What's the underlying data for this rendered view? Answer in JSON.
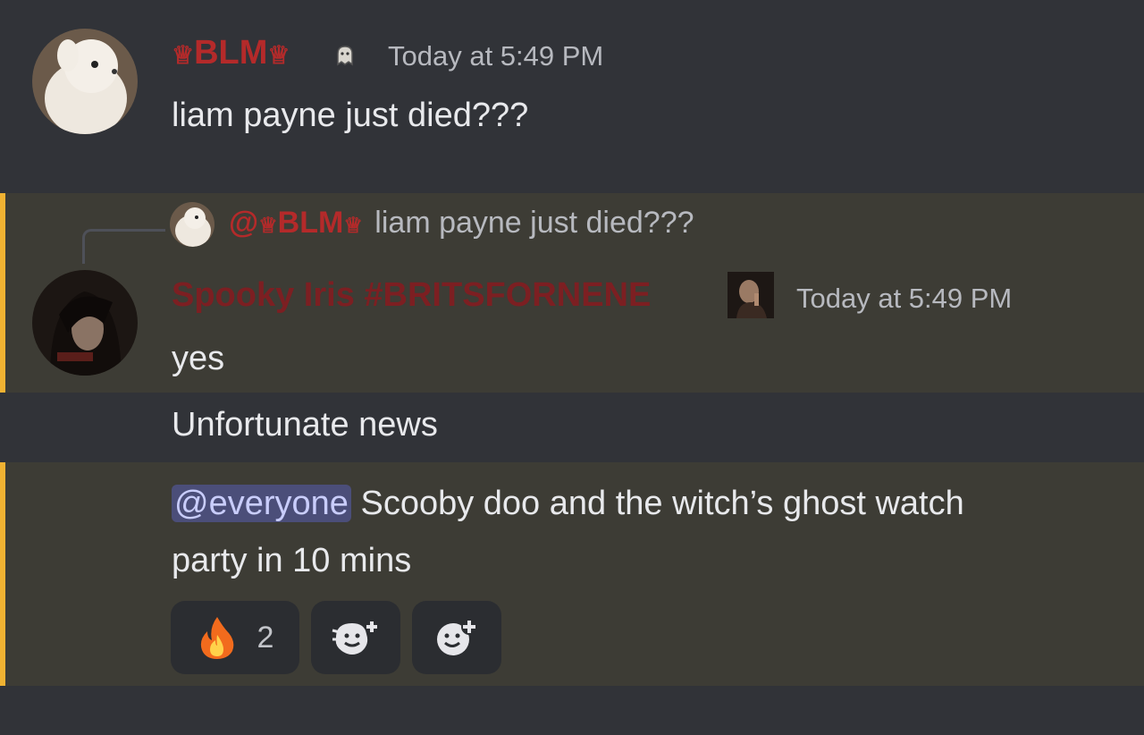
{
  "messages": [
    {
      "author": "BLM",
      "crown": "♕",
      "time": "Today at 5:49 PM",
      "text": "liam payne just died???"
    },
    {
      "reply": {
        "author": "BLM",
        "prefix": "@",
        "text": "liam payne just died???"
      },
      "author": "Spooky Iris #BRITSFORNENE",
      "time": "Today at 5:49 PM",
      "lines": [
        "yes",
        "Unfortunate news"
      ]
    },
    {
      "mention": "@everyone",
      "text_line1": "Scooby doo and the witch’s ghost watch",
      "text_line2": "party in 10 mins"
    }
  ],
  "reactions": [
    {
      "icon": "fire-emoji-icon",
      "count": "2"
    },
    {
      "icon": "add-super-reaction-icon"
    },
    {
      "icon": "add-reaction-icon"
    }
  ],
  "colors": {
    "background": "#313338",
    "highlight": "#3d3c35",
    "mention_bar": "#f0b232",
    "author_name": "#b42a2a",
    "mention_bg": "#4b4e79"
  }
}
